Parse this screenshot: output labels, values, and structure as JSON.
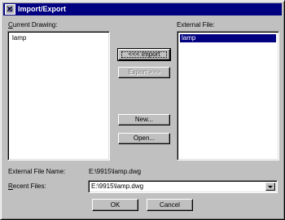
{
  "window": {
    "title": "Import/Export"
  },
  "current_drawing": {
    "label": "Current Drawing:",
    "items": [
      "lamp"
    ]
  },
  "external_file": {
    "label": "External File:",
    "items": [
      "lamp"
    ],
    "selected_index": 0
  },
  "buttons": {
    "import": "<<< Import",
    "export": "Export >>>",
    "new": "New...",
    "open": "Open...",
    "ok": "OK",
    "cancel": "Cancel"
  },
  "external_file_name": {
    "label": "External File Name:",
    "value": "E:\\9915\\lamp.dwg"
  },
  "recent_files": {
    "label": "Recent Files:",
    "value": "E:\\9915\\lamp.dwg"
  },
  "colors": {
    "face": "#c0c0c0",
    "titlebar": "#000080",
    "selection": "#000080"
  }
}
